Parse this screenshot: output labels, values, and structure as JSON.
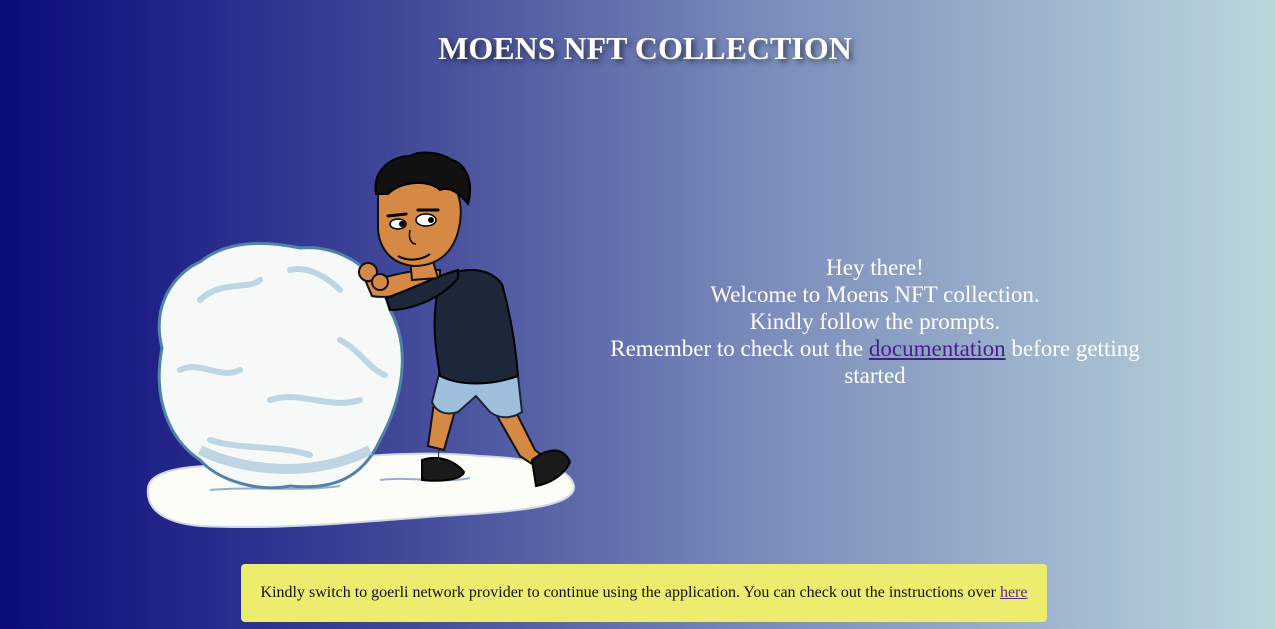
{
  "header": {
    "title": "MOENS NFT COLLECTION"
  },
  "hero": {
    "illustration": "bitmoji-pushing-snowball"
  },
  "welcome": {
    "line1": "Hey there!",
    "line2": "Welcome to Moens NFT collection.",
    "line3": "Kindly follow the prompts.",
    "line4_prefix": "Remember to check out the",
    "line4_link": "documentation",
    "line4_suffix": "before getting started"
  },
  "notice": {
    "text": "Kindly switch to goerli network provider to continue using the application. You can check out the instructions over",
    "link": "here"
  },
  "colors": {
    "gradient_start": "#0b0a7c",
    "gradient_end": "#bcd6dc",
    "notice_bg": "#ecec6e",
    "link": "#4a1d8a"
  }
}
